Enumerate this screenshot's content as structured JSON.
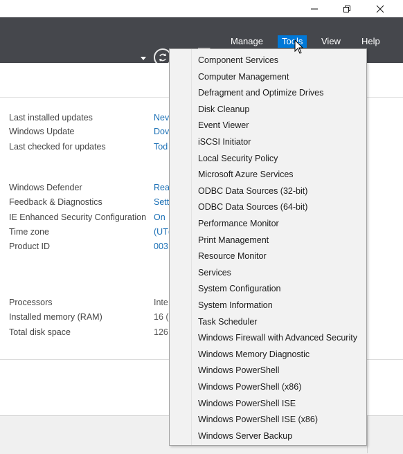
{
  "window_controls": {
    "minimize_icon": "minimize-icon",
    "restore_icon": "restore-icon",
    "close_icon": "close-icon"
  },
  "menubar": {
    "items": [
      "Manage",
      "Tools",
      "View",
      "Help"
    ],
    "active": "Tools"
  },
  "properties": {
    "group1": [
      {
        "label": "Last installed updates",
        "value": "Nev"
      },
      {
        "label": "Windows Update",
        "value": "Dov"
      },
      {
        "label": "Last checked for updates",
        "value": "Tod"
      }
    ],
    "group2": [
      {
        "label": "Windows Defender",
        "value": "Rea"
      },
      {
        "label": "Feedback & Diagnostics",
        "value": "Sett"
      },
      {
        "label": "IE Enhanced Security Configuration",
        "value": "On"
      },
      {
        "label": "Time zone",
        "value": "(UT("
      },
      {
        "label": "Product ID",
        "value": "003"
      }
    ],
    "group3": [
      {
        "label": "Processors",
        "value": "Inte"
      },
      {
        "label": "Installed memory (RAM)",
        "value": "16 ("
      },
      {
        "label": "Total disk space",
        "value": "126"
      }
    ]
  },
  "tools_menu": [
    "Component Services",
    "Computer Management",
    "Defragment and Optimize Drives",
    "Disk Cleanup",
    "Event Viewer",
    "iSCSI Initiator",
    "Local Security Policy",
    "Microsoft Azure Services",
    "ODBC Data Sources (32-bit)",
    "ODBC Data Sources (64-bit)",
    "Performance Monitor",
    "Print Management",
    "Resource Monitor",
    "Services",
    "System Configuration",
    "System Information",
    "Task Scheduler",
    "Windows Firewall with Advanced Security",
    "Windows Memory Diagnostic",
    "Windows PowerShell",
    "Windows PowerShell (x86)",
    "Windows PowerShell ISE",
    "Windows PowerShell ISE (x86)",
    "Windows Server Backup"
  ],
  "colors": {
    "menubar_bg": "#45474c",
    "active_menu_bg": "#0078d7",
    "link_value": "#1a6fb5",
    "dropdown_bg": "#f2f2f2"
  }
}
